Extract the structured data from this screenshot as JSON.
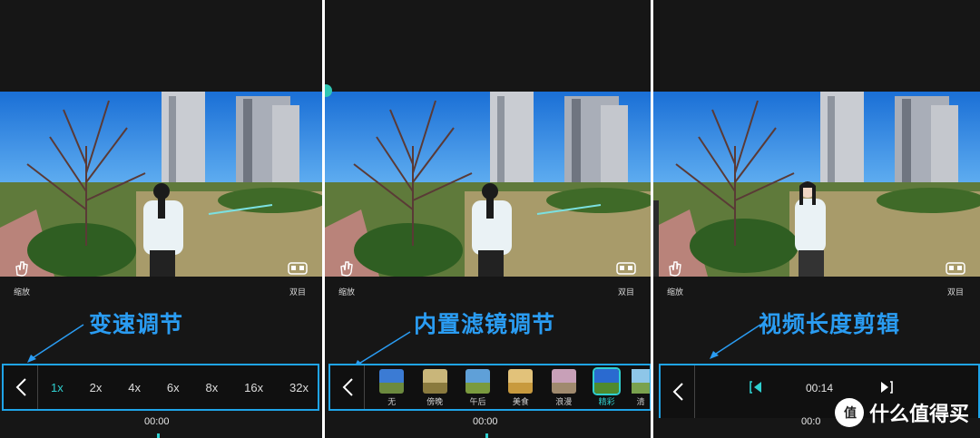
{
  "panels": [
    {
      "left_caption": "缩放",
      "right_caption": "双目",
      "title": "变速调节",
      "speeds": [
        "1x",
        "2x",
        "4x",
        "6x",
        "8x",
        "16x",
        "32x"
      ],
      "active_speed": "1x",
      "time": "00:00"
    },
    {
      "left_caption": "缩放",
      "right_caption": "双目",
      "title": "内置滤镜调节",
      "filters": [
        "无",
        "傍晚",
        "午后",
        "美食",
        "浪漫",
        "精彩",
        "清"
      ],
      "active_filter": "精彩",
      "time": "00:00"
    },
    {
      "left_caption": "缩放",
      "right_caption": "双目",
      "title": "视频长度剪辑",
      "trim_time": "00:14",
      "time": "00:0"
    }
  ],
  "watermark": {
    "text": "什么值得买",
    "icon": "smzdm-logo-icon"
  },
  "colors": {
    "accent": "#2fd0d0",
    "highlight_box": "#1fa4e8",
    "title": "#2a9cf2",
    "background": "#161616"
  }
}
